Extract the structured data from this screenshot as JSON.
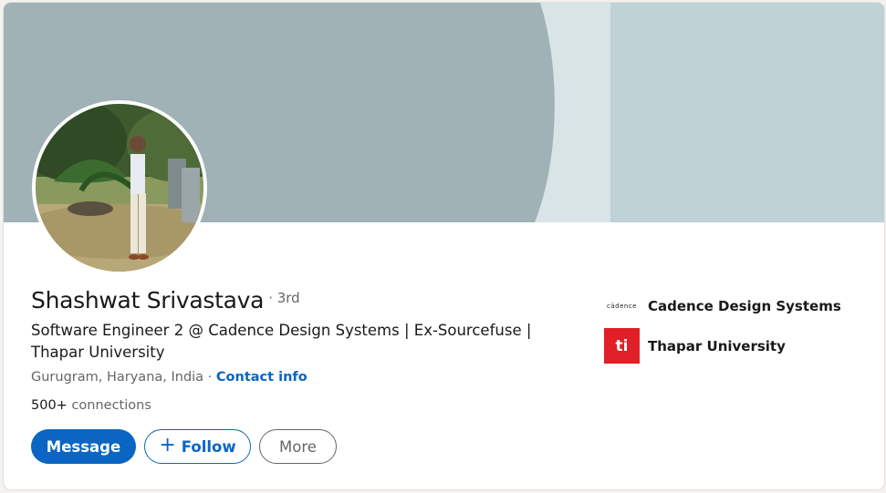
{
  "profile": {
    "name": "Shashwat Srivastava",
    "degree": "· 3rd",
    "headline": "Software Engineer 2 @ Cadence Design Systems | Ex-Sourcefuse | Thapar University",
    "location": "Gurugram, Haryana, India",
    "separator": " · ",
    "contact_info": "Contact info",
    "connections_count": "500+",
    "connections_label": " connections"
  },
  "actions": {
    "message": "Message",
    "follow": "Follow",
    "more": "More"
  },
  "organizations": [
    {
      "name": "Cadence Design Systems",
      "logo_text": "cādence",
      "icon": "cadence-logo"
    },
    {
      "name": "Thapar University",
      "logo_text": "ti",
      "icon": "thapar-logo"
    }
  ],
  "colors": {
    "accent": "#0a66c2",
    "banner_dark": "#a0b2b6",
    "banner_mid": "#d8e4e6",
    "banner_light": "#bfd2d6",
    "thapar_red": "#e01f26"
  },
  "icons": {
    "follow": "plus-icon"
  }
}
